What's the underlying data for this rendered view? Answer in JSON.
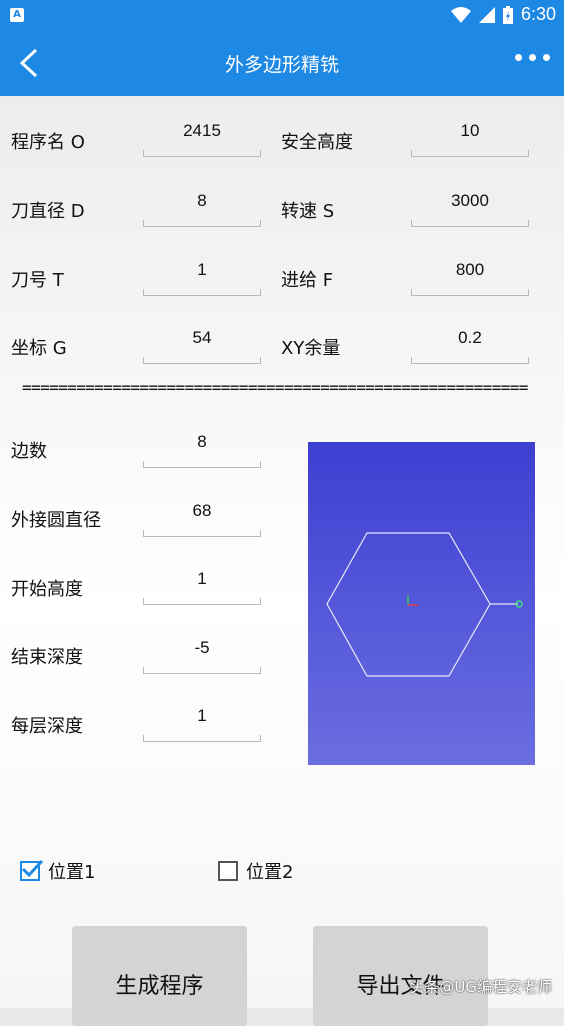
{
  "status_bar": {
    "time": "6:30",
    "app_badge": "A"
  },
  "app_bar": {
    "title": "外多边形精铣"
  },
  "params": [
    {
      "label": "程序名 O",
      "value": "2415"
    },
    {
      "label": "安全高度",
      "value": "10"
    },
    {
      "label": "刀直径 D",
      "value": "8"
    },
    {
      "label": "转速 S",
      "value": "3000"
    },
    {
      "label": "刀号 T",
      "value": "1"
    },
    {
      "label": "进给 F",
      "value": "800"
    },
    {
      "label": "坐标 G",
      "value": "54"
    },
    {
      "label": "XY余量",
      "value": "0.2"
    }
  ],
  "divider_text": "========================================================",
  "shape": [
    {
      "label": "边数",
      "value": "8"
    },
    {
      "label": "外接圆直径",
      "value": "68"
    },
    {
      "label": "开始高度",
      "value": "1"
    },
    {
      "label": "结束深度",
      "value": "-5"
    },
    {
      "label": "每层深度",
      "value": "1"
    }
  ],
  "positions": [
    {
      "label": "位置1",
      "checked": true
    },
    {
      "label": "位置2",
      "checked": false
    }
  ],
  "buttons": {
    "generate": "生成程序",
    "export": "导出文件"
  },
  "watermark": "头条@UG编程安老师",
  "colors": {
    "primary": "#1e88e5",
    "preview_top": "#3d3fd2",
    "preview_bottom": "#6a6ee0"
  }
}
